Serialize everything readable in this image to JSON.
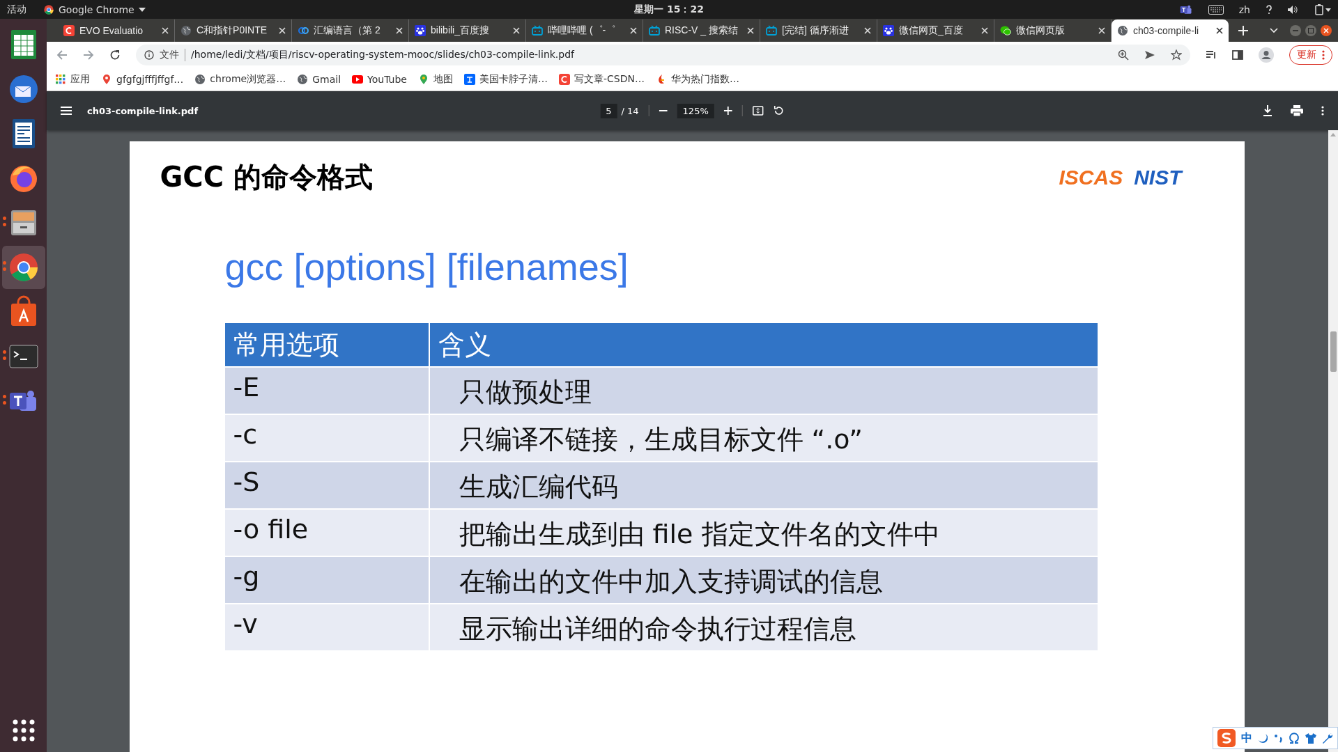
{
  "topbar": {
    "activities": "活动",
    "app_menu": "Google Chrome",
    "clock": "星期一 15：22",
    "input_method": "zh"
  },
  "dock": [
    {
      "kind": "sheet",
      "running": false,
      "selected": false
    },
    {
      "kind": "mail",
      "running": false,
      "selected": false
    },
    {
      "kind": "doc",
      "running": false,
      "selected": false
    },
    {
      "kind": "fox",
      "running": false,
      "selected": false
    },
    {
      "kind": "files",
      "running": true,
      "selected": false
    },
    {
      "kind": "chrome",
      "running": true,
      "selected": true
    },
    {
      "kind": "store",
      "running": false,
      "selected": false
    },
    {
      "kind": "terminal",
      "running": true,
      "selected": false
    },
    {
      "kind": "teams",
      "running": true,
      "selected": false
    }
  ],
  "tabs": [
    {
      "title": "EVO Evaluatio",
      "kind": "letter",
      "selected": false
    },
    {
      "title": "C和指针P0INTE",
      "kind": "globe",
      "selected": false
    },
    {
      "title": "汇编语言（第 2",
      "kind": "rings",
      "selected": false
    },
    {
      "title": "bilibili_百度搜",
      "kind": "paw",
      "selected": false
    },
    {
      "title": "哔哩哔哩 (゜-゜",
      "kind": "tv",
      "selected": false
    },
    {
      "title": "RISC-V _ 搜索结",
      "kind": "tv",
      "selected": false
    },
    {
      "title": "[完结] 循序渐进",
      "kind": "tv",
      "selected": false
    },
    {
      "title": "微信网页_百度",
      "kind": "paw",
      "selected": false
    },
    {
      "title": "微信网页版",
      "kind": "chat",
      "selected": false
    },
    {
      "title": "ch03-compile-li",
      "kind": "globe",
      "selected": true
    }
  ],
  "address": {
    "scheme_label": "文件",
    "url": "/home/ledi/文档/项目/riscv-operating-system-mooc/slides/ch03-compile-link.pdf",
    "update_button": "更新"
  },
  "bookmarks": [
    {
      "label": "应用",
      "kind": "apps"
    },
    {
      "label": "gfgfgjfffjffgf…",
      "kind": "pin"
    },
    {
      "label": "chrome浏览器…",
      "kind": "globe"
    },
    {
      "label": "Gmail",
      "kind": "globe"
    },
    {
      "label": "YouTube",
      "kind": "play"
    },
    {
      "label": "地图",
      "kind": "map"
    },
    {
      "label": "美国卡脖子清…",
      "kind": "zhi"
    },
    {
      "label": "写文章-CSDN…",
      "kind": "letter"
    },
    {
      "label": "华为热门指数…",
      "kind": "flame"
    }
  ],
  "pdf_toolbar": {
    "filename": "ch03-compile-link.pdf",
    "page": "5",
    "page_total": "/ 14",
    "zoom": "125%"
  },
  "slide": {
    "heading": "GCC 的命令格式",
    "logos": [
      "ISCAS",
      "NIST"
    ],
    "command": "gcc [options] [filenames]",
    "table": {
      "columns": [
        "常用选项",
        "含义"
      ],
      "rows": [
        [
          "-E",
          "只做预处理"
        ],
        [
          "-c",
          "只编译不链接，生成目标文件 “.o”"
        ],
        [
          "-S",
          "生成汇编代码"
        ],
        [
          "-o file",
          "把输出生成到由 file 指定文件名的文件中"
        ],
        [
          "-g",
          "在输出的文件中加入支持调试的信息"
        ],
        [
          "-v",
          "显示输出详细的命令执行过程信息"
        ]
      ]
    }
  },
  "ime_bar": {
    "mode": "中"
  }
}
